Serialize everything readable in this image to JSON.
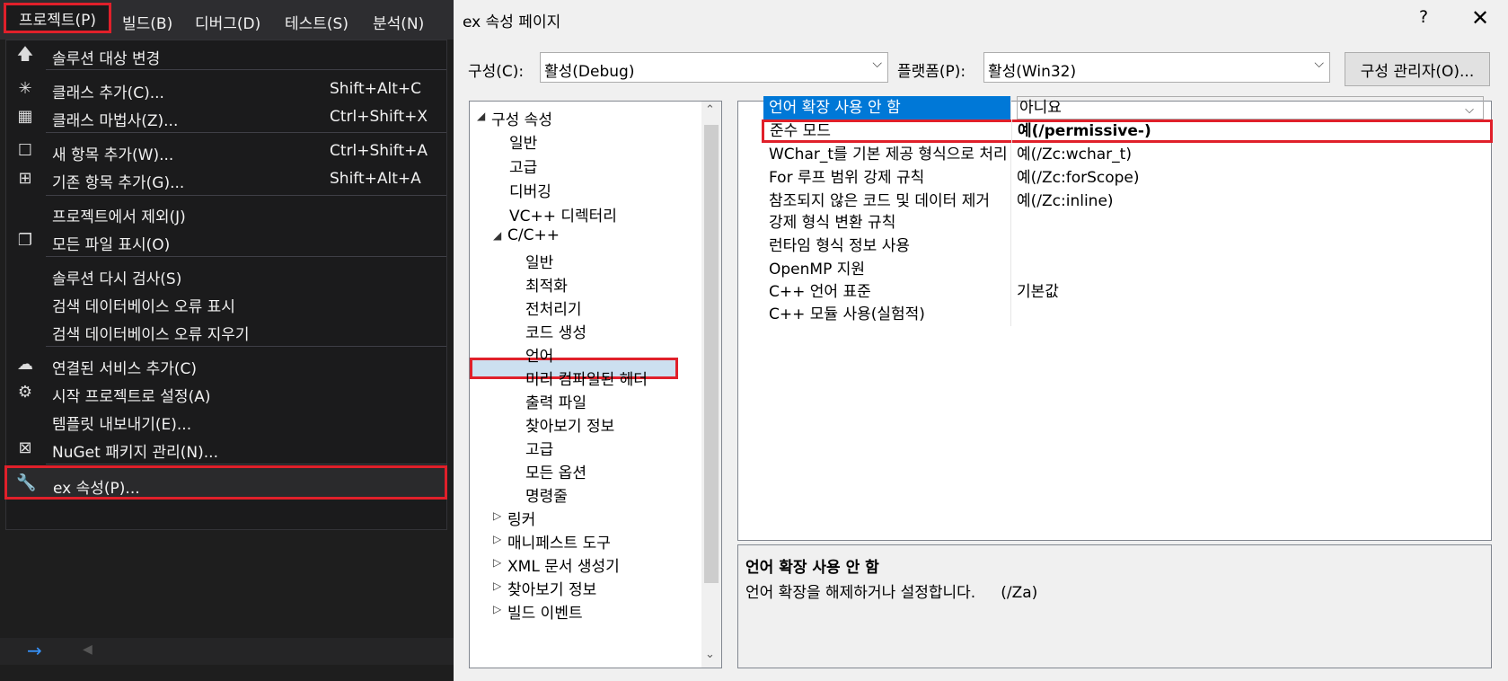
{
  "menubar": {
    "items": [
      "프로젝트(P)",
      "빌드(B)",
      "디버그(D)",
      "테스트(S)",
      "분석(N)"
    ]
  },
  "menu": {
    "items": [
      {
        "label": "솔루션 대상 변경",
        "shortcut": "",
        "icon": "arrow-up-icon"
      },
      {
        "label": "클래스 추가(C)...",
        "shortcut": "Shift+Alt+C",
        "icon": "add-class-icon"
      },
      {
        "label": "클래스 마법사(Z)...",
        "shortcut": "Ctrl+Shift+X",
        "icon": "class-wizard-icon"
      },
      {
        "label": "새 항목 추가(W)...",
        "shortcut": "Ctrl+Shift+A",
        "icon": "new-item-icon"
      },
      {
        "label": "기존 항목 추가(G)...",
        "shortcut": "Shift+Alt+A",
        "icon": "existing-item-icon"
      },
      {
        "label": "프로젝트에서 제외(J)",
        "shortcut": "",
        "icon": ""
      },
      {
        "label": "모든 파일 표시(O)",
        "shortcut": "",
        "icon": "show-files-icon"
      },
      {
        "label": "솔루션 다시 검사(S)",
        "shortcut": "",
        "icon": ""
      },
      {
        "label": "검색 데이터베이스 오류 표시",
        "shortcut": "",
        "icon": ""
      },
      {
        "label": "검색 데이터베이스 오류 지우기",
        "shortcut": "",
        "icon": ""
      },
      {
        "label": "연결된 서비스 추가(C)",
        "shortcut": "",
        "icon": "connected-service-icon"
      },
      {
        "label": "시작 프로젝트로 설정(A)",
        "shortcut": "",
        "icon": "gear-icon"
      },
      {
        "label": "템플릿 내보내기(E)...",
        "shortcut": "",
        "icon": ""
      },
      {
        "label": "NuGet 패키지 관리(N)...",
        "shortcut": "",
        "icon": "package-icon"
      },
      {
        "label": "ex 속성(P)...",
        "shortcut": "",
        "icon": "wrench-icon"
      }
    ]
  },
  "dialog": {
    "title": "ex 속성 페이지",
    "help": "?",
    "close": "✕",
    "config_label": "구성(C):",
    "config_value": "활성(Debug)",
    "platform_label": "플랫폼(P):",
    "platform_value": "활성(Win32)",
    "config_manager": "구성 관리자(O)..."
  },
  "tree": {
    "nodes": [
      {
        "label": "구성 속성",
        "level": 0,
        "toggle": "◢"
      },
      {
        "label": "일반",
        "level": 1,
        "toggle": ""
      },
      {
        "label": "고급",
        "level": 1,
        "toggle": ""
      },
      {
        "label": "디버깅",
        "level": 1,
        "toggle": ""
      },
      {
        "label": "VC++ 디렉터리",
        "level": 1,
        "toggle": ""
      },
      {
        "label": "C/C++",
        "level": 1,
        "toggle": "◢"
      },
      {
        "label": "일반",
        "level": 2,
        "toggle": ""
      },
      {
        "label": "최적화",
        "level": 2,
        "toggle": ""
      },
      {
        "label": "전처리기",
        "level": 2,
        "toggle": ""
      },
      {
        "label": "코드 생성",
        "level": 2,
        "toggle": ""
      },
      {
        "label": "언어",
        "level": 2,
        "toggle": ""
      },
      {
        "label": "미리 컴파일된 헤더",
        "level": 2,
        "toggle": ""
      },
      {
        "label": "출력 파일",
        "level": 2,
        "toggle": ""
      },
      {
        "label": "찾아보기 정보",
        "level": 2,
        "toggle": ""
      },
      {
        "label": "고급",
        "level": 2,
        "toggle": ""
      },
      {
        "label": "모든 옵션",
        "level": 2,
        "toggle": ""
      },
      {
        "label": "명령줄",
        "level": 2,
        "toggle": ""
      },
      {
        "label": "링커",
        "level": 1,
        "toggle": "▷"
      },
      {
        "label": "매니페스트 도구",
        "level": 1,
        "toggle": "▷"
      },
      {
        "label": "XML 문서 생성기",
        "level": 1,
        "toggle": "▷"
      },
      {
        "label": "찾아보기 정보",
        "level": 1,
        "toggle": "▷"
      },
      {
        "label": "빌드 이벤트",
        "level": 1,
        "toggle": "▷"
      }
    ],
    "selected": "언어"
  },
  "grid": {
    "rows": [
      {
        "name": "언어 확장 사용 안 함",
        "value": "아니요"
      },
      {
        "name": "준수 모드",
        "value": "예(/permissive-)"
      },
      {
        "name": "WChar_t를 기본 제공 형식으로 처리",
        "value": "예(/Zc:wchar_t)"
      },
      {
        "name": "For 루프 범위 강제 규칙",
        "value": "예(/Zc:forScope)"
      },
      {
        "name": "참조되지 않은 코드 및 데이터 제거",
        "value": "예(/Zc:inline)"
      },
      {
        "name": "강제 형식 변환 규칙",
        "value": ""
      },
      {
        "name": "런타임 형식 정보 사용",
        "value": ""
      },
      {
        "name": "OpenMP 지원",
        "value": ""
      },
      {
        "name": "C++ 언어 표준",
        "value": "기본값"
      },
      {
        "name": "C++ 모듈 사용(실험적)",
        "value": ""
      }
    ]
  },
  "description": {
    "title": "언어 확장 사용 안 함",
    "text": "언어 확장을 해제하거나 설정합니다.",
    "flag": "(/Za)"
  },
  "colors": {
    "highlight": "#e0202a",
    "selection": "#0078d7"
  }
}
